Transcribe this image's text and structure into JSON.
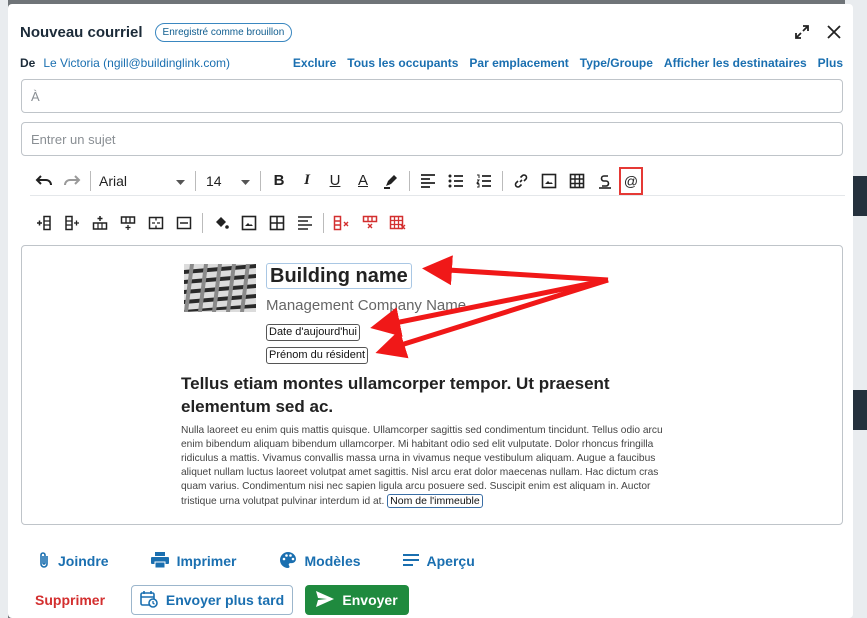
{
  "modal": {
    "title": "Nouveau courriel",
    "draft_badge": "Enregistré comme brouillon"
  },
  "from": {
    "label": "De",
    "value": "Le Victoria (ngill@buildinglink.com)",
    "links": [
      "Exclure",
      "Tous les occupants",
      "Par emplacement",
      "Type/Groupe",
      "Afficher les destinataires",
      "Plus"
    ]
  },
  "to": {
    "placeholder": "À"
  },
  "subject": {
    "placeholder": "Entrer un sujet"
  },
  "toolbar": {
    "font": "Arial",
    "size": "14",
    "bold": "B",
    "italic": "I",
    "underline": "U",
    "font_color": "A",
    "mention": "@"
  },
  "editor": {
    "building_name": "Building name",
    "management_name": "Management Company Name",
    "date_tag": "Date d'aujourd'hui",
    "resident_tag": "Prénom du résident",
    "headline": "Tellus etiam montes ullamcorper tempor. Ut praesent elementum sed ac.",
    "body": "Nulla laoreet eu enim quis mattis quisque. Ullamcorper sagittis sed condimentum tincidunt. Tellus odio arcu enim bibendum aliquam bibendum ullamcorper. Mi habitant odio sed elit vulputate. Dolor rhoncus fringilla ridiculus a mattis. Vivamus convallis massa urna in vivamus neque vestibulum aliquam. Augue a faucibus aliquet nullam luctus laoreet volutpat amet sagittis. Nisl arcu erat dolor maecenas nullam. Hac dictum cras quam varius. Condimentum nisi nec sapien ligula arcu posuere sed. Suscipit enim est aliquam in. Auctor tristique urna volutpat pulvinar interdum id at.",
    "building_tag": "Nom de l'immeuble"
  },
  "actions": {
    "attach": "Joindre",
    "print": "Imprimer",
    "templates": "Modèles",
    "preview": "Aperçu"
  },
  "footer": {
    "delete": "Supprimer",
    "send_later": "Envoyer plus tard",
    "send": "Envoyer"
  },
  "colors": {
    "accent": "#1a6fb0",
    "send": "#1f8a3e",
    "delete": "#d32f2f",
    "annotation": "#e53935"
  }
}
